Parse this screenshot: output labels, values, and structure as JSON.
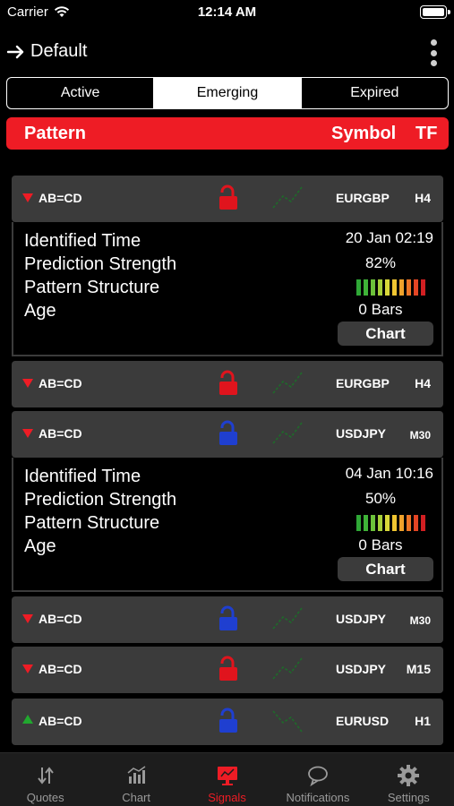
{
  "status": {
    "carrier": "Carrier",
    "time": "12:14 AM"
  },
  "nav": {
    "title": "Default"
  },
  "segments": [
    {
      "label": "Active",
      "selected": false
    },
    {
      "label": "Emerging",
      "selected": true
    },
    {
      "label": "Expired",
      "selected": false
    }
  ],
  "header": {
    "pattern": "Pattern",
    "symbol": "Symbol",
    "tf": "TF"
  },
  "detail_labels": {
    "identified": "Identified Time",
    "strength": "Prediction Strength",
    "structure": "Pattern Structure",
    "age": "Age",
    "chart_button": "Chart"
  },
  "structure_bar_colors": [
    "#2fa836",
    "#3fb338",
    "#6cc13a",
    "#a6cf3a",
    "#d8d83a",
    "#f0c531",
    "#f0a22b",
    "#ec7526",
    "#e44524",
    "#d21f22"
  ],
  "signals": [
    {
      "direction": "down",
      "pattern": "AB=CD",
      "lock": "red",
      "symbol": "EURGBP",
      "tf": "H4",
      "expanded": true,
      "details": {
        "identified_time": "20 Jan 02:19",
        "prediction_strength": "82%",
        "age": "0 Bars"
      }
    },
    {
      "direction": "down",
      "pattern": "AB=CD",
      "lock": "red",
      "symbol": "EURGBP",
      "tf": "H4",
      "expanded": false
    },
    {
      "direction": "down",
      "pattern": "AB=CD",
      "lock": "blue",
      "symbol": "USDJPY",
      "tf": "M30",
      "expanded": true,
      "details": {
        "identified_time": "04 Jan 10:16",
        "prediction_strength": "50%",
        "age": "0 Bars"
      }
    },
    {
      "direction": "down",
      "pattern": "AB=CD",
      "lock": "blue",
      "symbol": "USDJPY",
      "tf": "M30",
      "expanded": false
    },
    {
      "direction": "down",
      "pattern": "AB=CD",
      "lock": "red",
      "symbol": "USDJPY",
      "tf": "M15",
      "expanded": false
    },
    {
      "direction": "up",
      "pattern": "AB=CD",
      "lock": "blue",
      "symbol": "EURUSD",
      "tf": "H1",
      "expanded": false
    }
  ],
  "tabs": [
    {
      "label": "Quotes",
      "icon": "quotes-icon",
      "active": false
    },
    {
      "label": "Chart",
      "icon": "chart-icon",
      "active": false
    },
    {
      "label": "Signals",
      "icon": "signals-icon",
      "active": true
    },
    {
      "label": "Notifications",
      "icon": "notifications-icon",
      "active": false
    },
    {
      "label": "Settings",
      "icon": "settings-icon",
      "active": false
    }
  ]
}
